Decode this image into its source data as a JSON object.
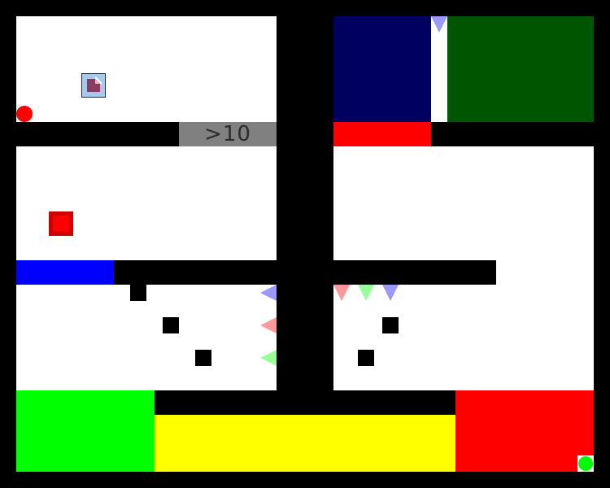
{
  "colors": {
    "wall": "#000000",
    "floor": "#ffffff",
    "navy": "#000060",
    "dark_green": "#005500",
    "bright_green": "#00ff00",
    "yellow": "#ffff00",
    "red": "#ff0000",
    "blue": "#0000ff",
    "gray_gate": "#808080",
    "key_blue": "#9999ff",
    "key_pink": "#ff9999",
    "key_green": "#99ff99"
  },
  "gate": {
    "label": ">10"
  },
  "entities": {
    "player_icon": "player-card-icon",
    "red_block": "red-square-block",
    "red_ball": "red-ball",
    "green_ball": "green-ball"
  }
}
